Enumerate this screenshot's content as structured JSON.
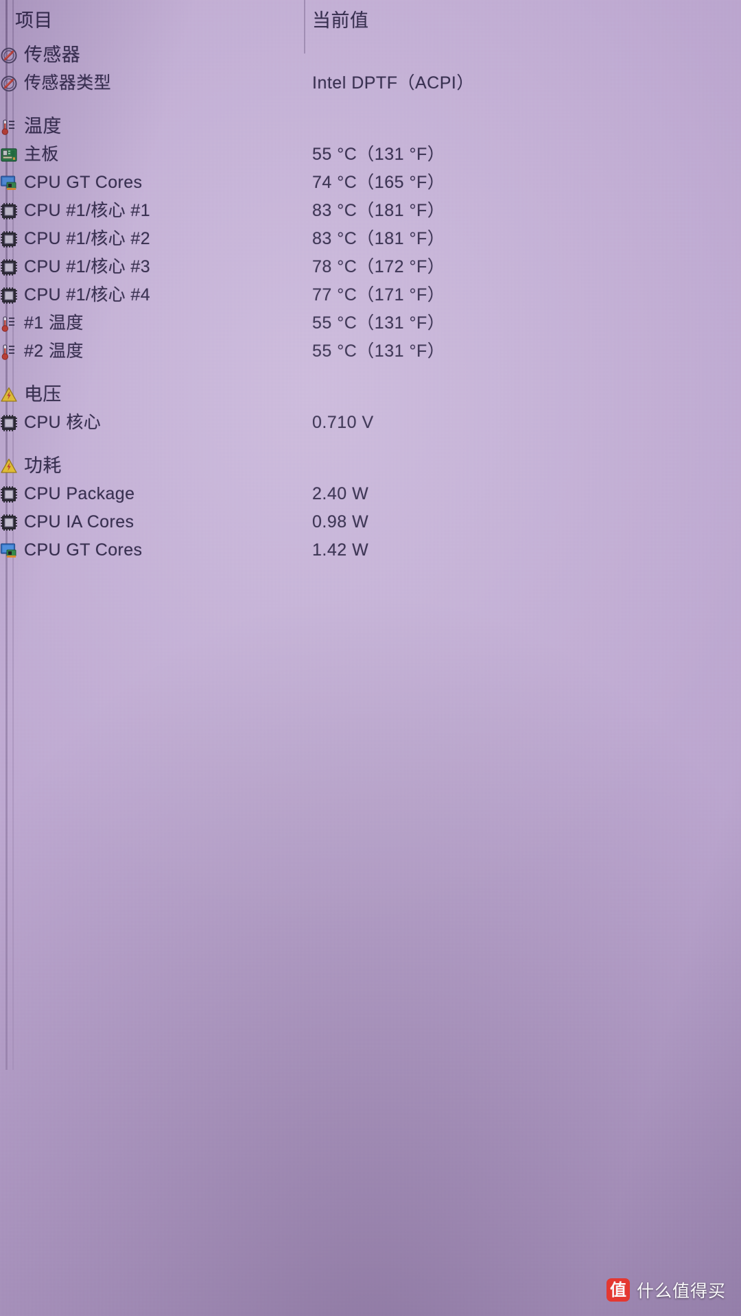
{
  "app": {
    "style": "hwinfo-sensor-tree",
    "background_color": "#bfaad2",
    "text_color": "#2e2647"
  },
  "header": {
    "col_item": "项目",
    "col_value": "当前值"
  },
  "sections": [
    {
      "id": "sensor",
      "icon": "sensor-icon",
      "title": "传感器",
      "rows": [
        {
          "icon": "sensor-icon",
          "label": "传感器类型",
          "value": "Intel DPTF（ACPI）",
          "indent": 2
        }
      ]
    },
    {
      "id": "temperature",
      "icon": "thermometer-icon",
      "title": "温度",
      "rows": [
        {
          "icon": "motherboard-icon",
          "label": "主板",
          "value": "55 °C（131 °F）",
          "indent": 1
        },
        {
          "icon": "gpu-monitor-icon",
          "label": "CPU GT Cores",
          "value": "74 °C（165 °F）",
          "indent": 1
        },
        {
          "icon": "cpu-chip-icon",
          "label": "CPU #1/核心 #1",
          "value": "83 °C（181 °F）",
          "indent": 1
        },
        {
          "icon": "cpu-chip-icon",
          "label": "CPU #1/核心 #2",
          "value": "83 °C（181 °F）",
          "indent": 1
        },
        {
          "icon": "cpu-chip-icon",
          "label": "CPU #1/核心 #3",
          "value": "78 °C（172 °F）",
          "indent": 1
        },
        {
          "icon": "cpu-chip-icon",
          "label": "CPU #1/核心 #4",
          "value": "77 °C（171 °F）",
          "indent": 1
        },
        {
          "icon": "thermometer-icon",
          "label": "#1 温度",
          "value": "55 °C（131 °F）",
          "indent": 1
        },
        {
          "icon": "thermometer-icon",
          "label": "#2 温度",
          "value": "55 °C（131 °F）",
          "indent": 1
        }
      ]
    },
    {
      "id": "voltage",
      "icon": "warning-bolt-icon",
      "title": "电压",
      "rows": [
        {
          "icon": "cpu-chip-icon",
          "label": "CPU 核心",
          "value": "0.710 V",
          "indent": 1
        }
      ]
    },
    {
      "id": "power",
      "icon": "warning-bolt-icon",
      "title": "功耗",
      "rows": [
        {
          "icon": "cpu-chip-icon",
          "label": "CPU Package",
          "value": "2.40 W",
          "indent": 1
        },
        {
          "icon": "cpu-chip-icon",
          "label": "CPU IA Cores",
          "value": "0.98 W",
          "indent": 1
        },
        {
          "icon": "gpu-monitor-icon",
          "label": "CPU GT Cores",
          "value": "1.42 W",
          "indent": 1
        }
      ]
    }
  ],
  "watermark": {
    "badge": "值",
    "text": "什么值得买",
    "badge_color": "#e8342b"
  }
}
